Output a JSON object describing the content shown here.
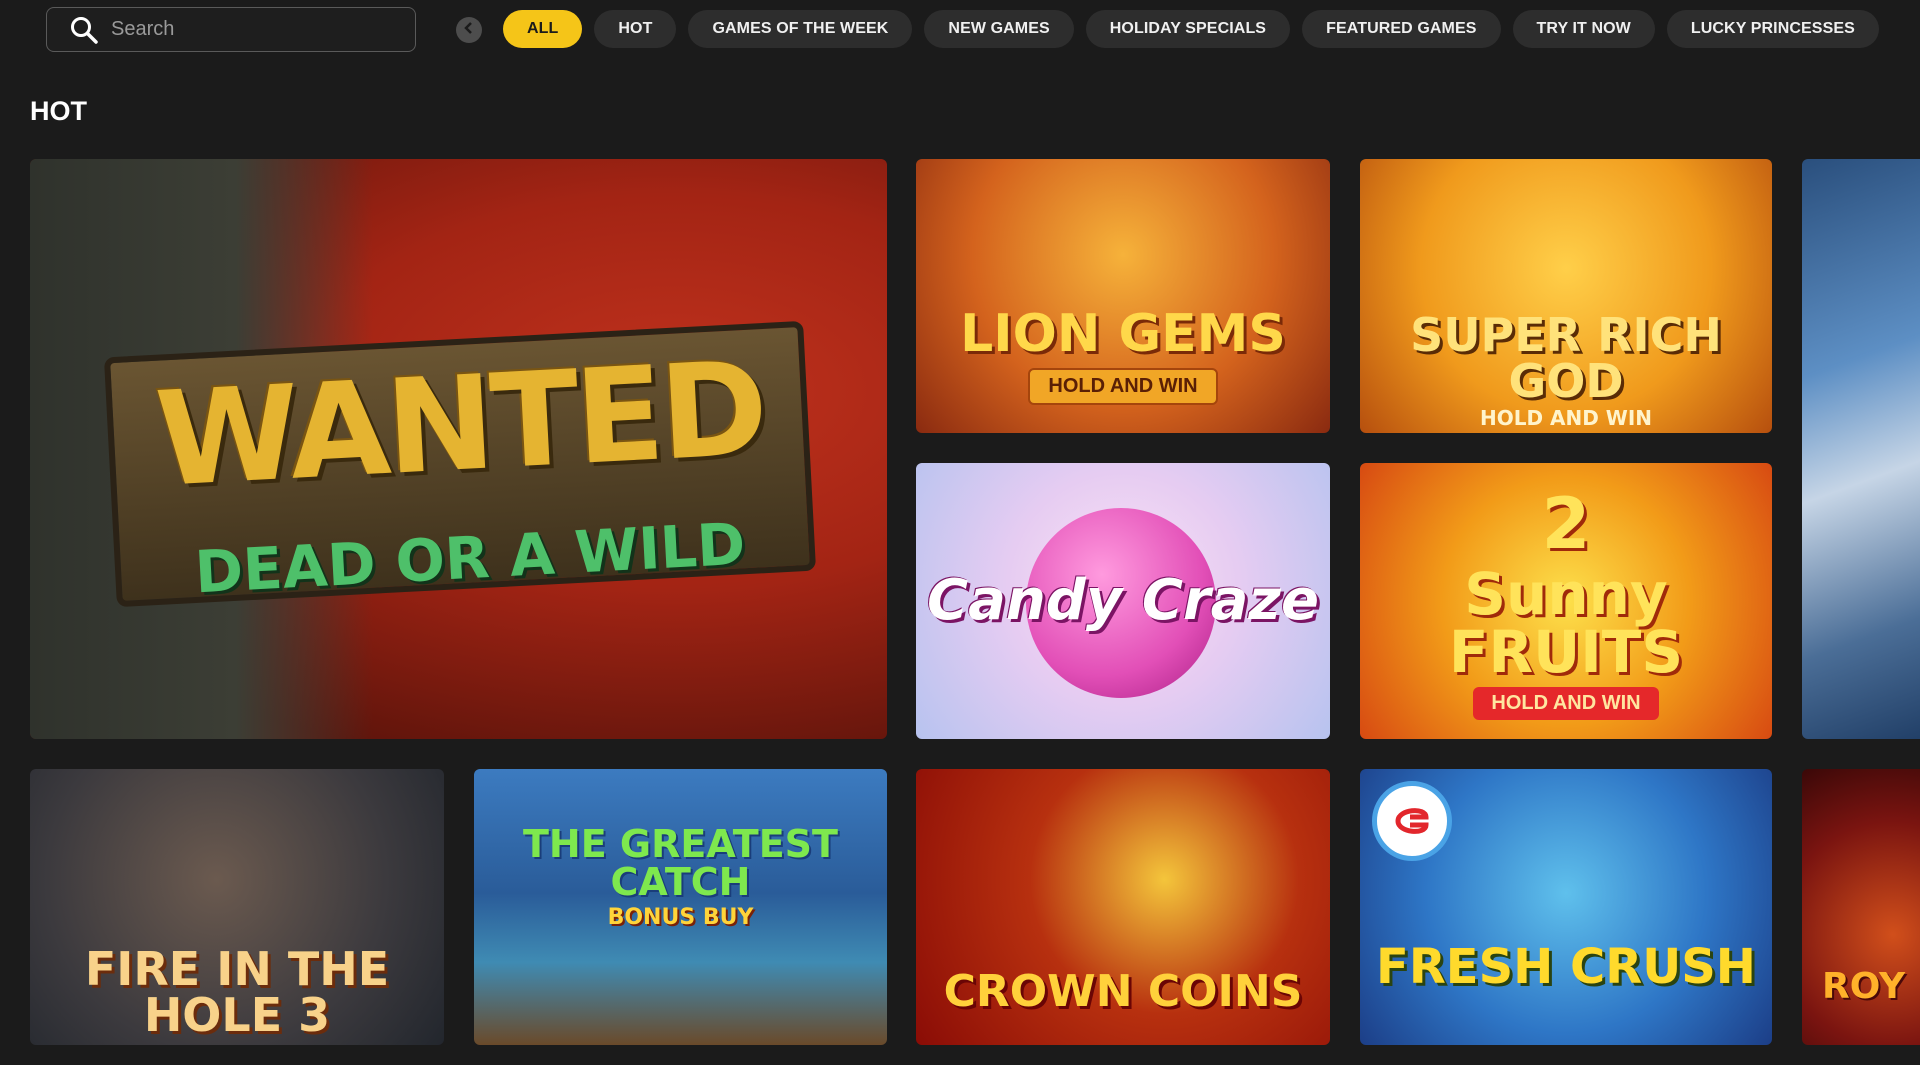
{
  "search": {
    "placeholder": "Search",
    "value": ""
  },
  "tabs": [
    {
      "label": "ALL",
      "active": true
    },
    {
      "label": "HOT",
      "active": false
    },
    {
      "label": "GAMES OF THE WEEK",
      "active": false
    },
    {
      "label": "NEW GAMES",
      "active": false
    },
    {
      "label": "HOLIDAY SPECIALS",
      "active": false
    },
    {
      "label": "FEATURED GAMES",
      "active": false
    },
    {
      "label": "TRY IT NOW",
      "active": false
    },
    {
      "label": "LUCKY PRINCESSES",
      "active": false
    }
  ],
  "accent_color": "#f5c518",
  "section": {
    "title": "HOT"
  },
  "games": {
    "wanted": {
      "title": "WANTED",
      "subtitle": "DEAD OR A WILD"
    },
    "lion_gems": {
      "title": "LION GEMS",
      "subtitle": "HOLD AND WIN"
    },
    "super_rich_god": {
      "title": "SUPER RICH GOD",
      "subtitle": "HOLD AND WIN"
    },
    "candy_craze": {
      "title": "Candy Craze"
    },
    "sunny_fruits": {
      "number": "2",
      "title": "Sunny FRUITS",
      "subtitle": "HOLD AND WIN"
    },
    "fire_in_the_hole": {
      "title": "FIRE IN THE HOLE 3"
    },
    "greatest_catch": {
      "title": "THE GREATEST CATCH",
      "subtitle": "BONUS BUY"
    },
    "crown_coins": {
      "title": "CROWN COINS"
    },
    "fresh_crush": {
      "title": "FRESH CRUSH"
    },
    "partial_royal": {
      "title": "ROY"
    }
  },
  "icons": {
    "search": "search-icon",
    "prev": "chevron-left-icon"
  }
}
